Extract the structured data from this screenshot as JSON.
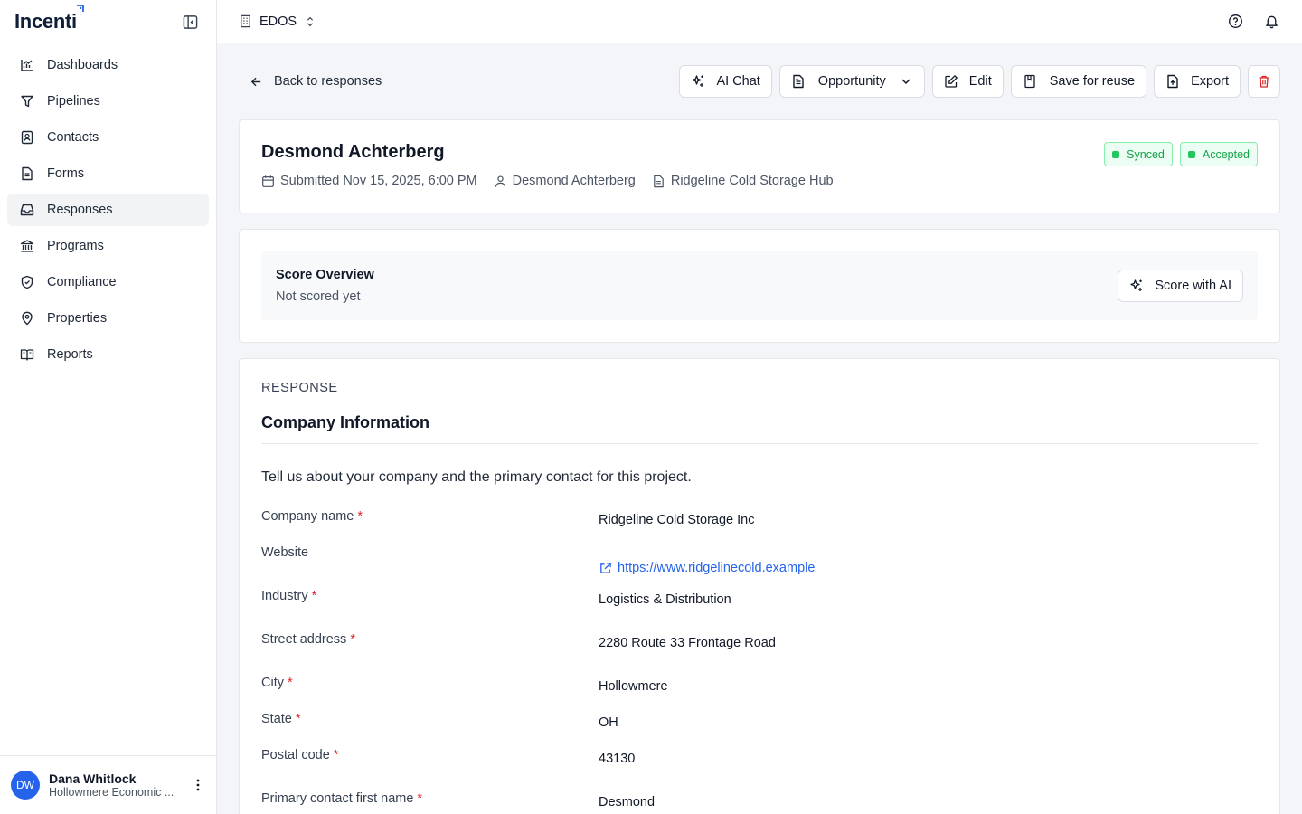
{
  "app": {
    "logo": "Incenti"
  },
  "sidebar": {
    "items": [
      {
        "label": "Dashboards",
        "icon": "chart-icon"
      },
      {
        "label": "Pipelines",
        "icon": "filter-icon"
      },
      {
        "label": "Contacts",
        "icon": "contact-icon"
      },
      {
        "label": "Forms",
        "icon": "form-icon"
      },
      {
        "label": "Responses",
        "icon": "inbox-icon",
        "active": true
      },
      {
        "label": "Programs",
        "icon": "bank-icon"
      },
      {
        "label": "Compliance",
        "icon": "shield-icon"
      },
      {
        "label": "Properties",
        "icon": "map-pin-icon"
      },
      {
        "label": "Reports",
        "icon": "book-icon"
      }
    ],
    "user": {
      "initials": "DW",
      "name": "Dana Whitlock",
      "org": "Hollowmere Economic ..."
    }
  },
  "topbar": {
    "org_name": "EDOS"
  },
  "toolbar": {
    "back_label": "Back to responses",
    "ai_chat_label": "AI Chat",
    "opportunity_label": "Opportunity",
    "edit_label": "Edit",
    "save_reuse_label": "Save for reuse",
    "export_label": "Export"
  },
  "response": {
    "title": "Desmond Achterberg",
    "submitted": "Submitted Nov 15, 2025, 6:00 PM",
    "submitter": "Desmond Achterberg",
    "project": "Ridgeline Cold Storage Hub",
    "badges": [
      "Synced",
      "Accepted"
    ]
  },
  "score": {
    "title": "Score Overview",
    "status": "Not scored yet",
    "button_label": "Score with AI"
  },
  "section": {
    "label": "RESPONSE",
    "title": "Company Information",
    "description": "Tell us about your company and the primary contact for this project.",
    "fields": [
      {
        "label": "Company name",
        "required": true,
        "value": "Ridgeline Cold Storage Inc"
      },
      {
        "label": "Website",
        "required": false,
        "value": "https://www.ridgelinecold.example"
      },
      {
        "label": "Industry",
        "required": true,
        "value": "Logistics & Distribution"
      },
      {
        "label": "Street address",
        "required": true,
        "value": "2280 Route 33 Frontage Road"
      },
      {
        "label": "City",
        "required": true,
        "value": "Hollowmere"
      },
      {
        "label": "State",
        "required": true,
        "value": "OH"
      },
      {
        "label": "Postal code",
        "required": true,
        "value": "43130"
      },
      {
        "label": "Primary contact first name",
        "required": true,
        "value": "Desmond"
      }
    ]
  },
  "colors": {
    "accent": "#2563eb",
    "success": "#16a34a",
    "danger": "#dc2626"
  }
}
